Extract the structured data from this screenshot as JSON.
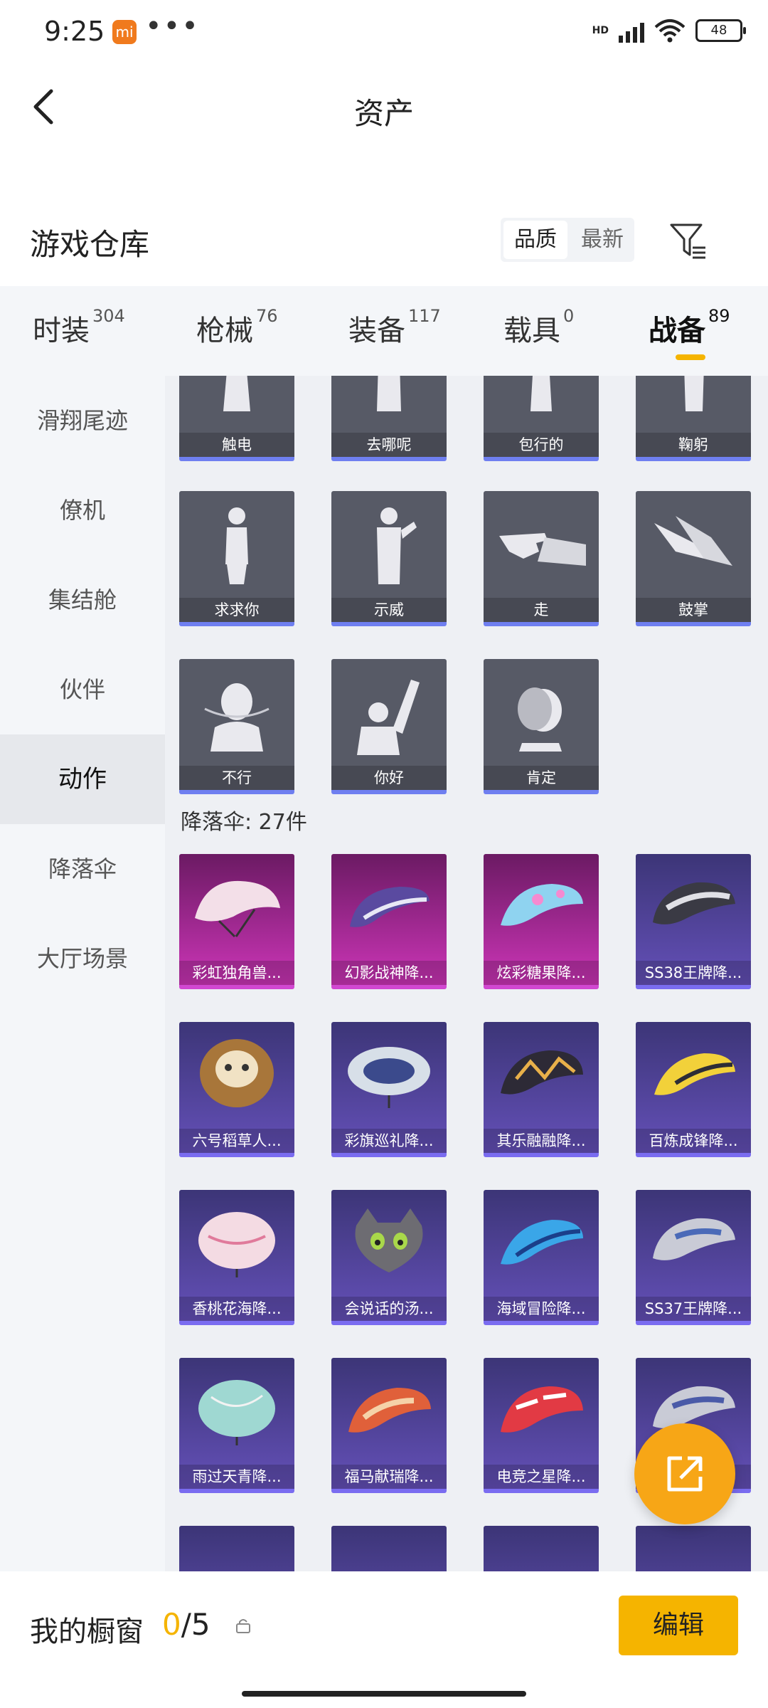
{
  "status": {
    "time": "9:25",
    "battery": "48",
    "network": "HD"
  },
  "header": {
    "title": "资产"
  },
  "warehouse": {
    "title": "游戏仓库",
    "sort": [
      "品质",
      "最新"
    ]
  },
  "tabs": [
    {
      "label": "时装",
      "count": "304"
    },
    {
      "label": "枪械",
      "count": "76"
    },
    {
      "label": "装备",
      "count": "117"
    },
    {
      "label": "载具",
      "count": "0"
    },
    {
      "label": "战备",
      "count": "89"
    }
  ],
  "sidebar": {
    "items": [
      "滑翔尾迹",
      "僚机",
      "集结舱",
      "伙伴",
      "动作",
      "降落伞",
      "大厅场景"
    ]
  },
  "actions": [
    "触电",
    "去哪呢",
    "包行的",
    "鞠躬",
    "求求你",
    "示威",
    "走",
    "鼓掌",
    "不行",
    "你好",
    "肯定"
  ],
  "parachute_section": {
    "label": "降落伞: 27件"
  },
  "parachutes": [
    "彩虹独角兽...",
    "幻影战神降...",
    "炫彩糖果降...",
    "SS38王牌降...",
    "六号稻草人...",
    "彩旗巡礼降...",
    "其乐融融降...",
    "百炼成锋降...",
    "香桃花海降...",
    "会说话的汤...",
    "海域冒险降...",
    "SS37王牌降...",
    "雨过天青降...",
    "福马献瑞降...",
    "电竞之星降...",
    ""
  ],
  "bottom": {
    "label": "我的橱窗",
    "used": "0",
    "total": "/5",
    "edit": "编辑"
  },
  "colors": {
    "accent": "#f5b400",
    "fab": "#f7a616",
    "rare_pink": "#cc35b7",
    "epic_purple": "#6450b8"
  }
}
